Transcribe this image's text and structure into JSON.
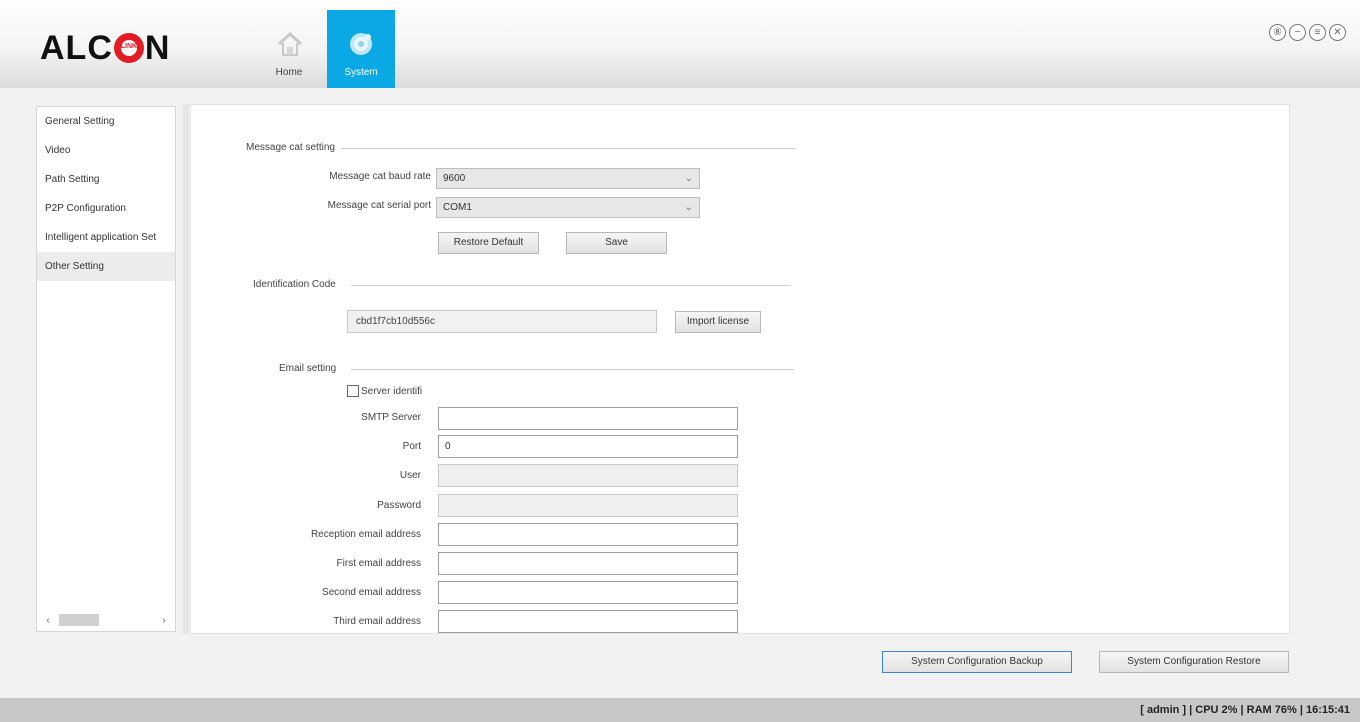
{
  "header": {
    "logo_text_left": "ALC",
    "logo_ring_text": "LINK",
    "logo_text_right": "N",
    "nav": [
      {
        "label": "Home",
        "icon": "home-icon",
        "active": false
      },
      {
        "label": "System",
        "icon": "gear-icon",
        "active": true
      }
    ],
    "window_controls": [
      {
        "icon": "lock-icon",
        "glyph": "⑧"
      },
      {
        "icon": "minimize-icon",
        "glyph": "−"
      },
      {
        "icon": "restore-icon",
        "glyph": "≡"
      },
      {
        "icon": "close-icon",
        "glyph": "✕"
      }
    ]
  },
  "sidebar": {
    "items": [
      {
        "label": "General Setting",
        "active": false
      },
      {
        "label": "Video",
        "active": false
      },
      {
        "label": "Path Setting",
        "active": false
      },
      {
        "label": "P2P Configuration",
        "active": false
      },
      {
        "label": "Intelligent application Set",
        "active": false
      },
      {
        "label": "Other Setting",
        "active": true
      }
    ],
    "scroll_left": "‹",
    "scroll_right": "›"
  },
  "message_cat": {
    "title": "Message cat setting",
    "baud_label": "Message cat baud rate",
    "baud_value": "9600",
    "port_label": "Message cat serial port",
    "port_value": "COM1",
    "restore_label": "Restore Default",
    "save_label": "Save"
  },
  "identification": {
    "title": "Identification Code",
    "code": "cbd1f7cb10d556c",
    "import_label": "Import license"
  },
  "email": {
    "title": "Email setting",
    "server_ident_label": "Server identifi",
    "smtp_label": "SMTP Server",
    "smtp_value": "",
    "port_label": "Port",
    "port_value": "0",
    "user_label": "User",
    "user_value": "",
    "password_label": "Password",
    "password_value": "",
    "reception_label": "Reception email address",
    "reception_value": "",
    "first_label": "First email address",
    "first_value": "",
    "second_label": "Second email address",
    "second_value": "",
    "third_label": "Third email address",
    "third_value": ""
  },
  "footer_buttons": {
    "backup_label": "System Configuration Backup",
    "restore_label": "System Configuration Restore"
  },
  "status": {
    "text": "[ admin ] | CPU  2% | RAM  76% | 16:15:41"
  },
  "colors": {
    "accent": "#0aa9e6",
    "logo_red": "#e21c24"
  }
}
